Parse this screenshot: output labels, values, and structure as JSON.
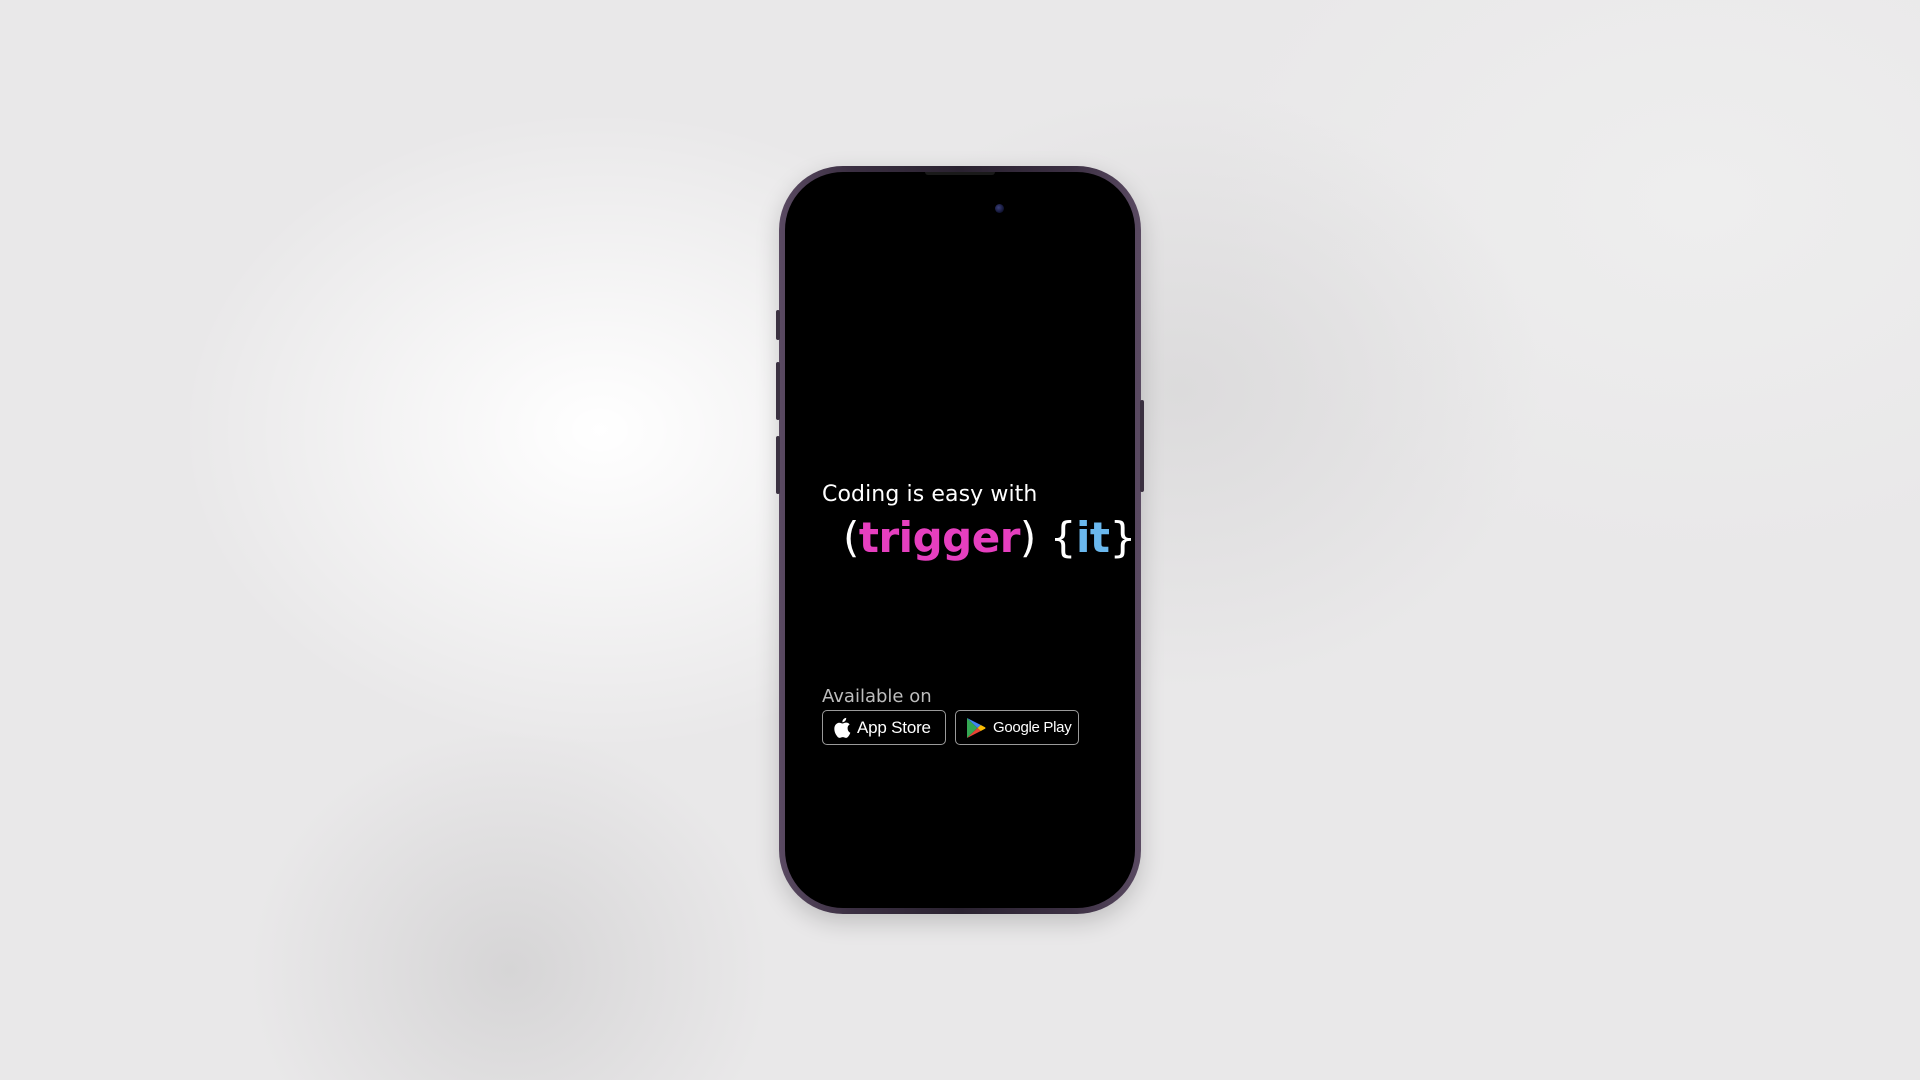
{
  "screen": {
    "headline": "Coding is easy with",
    "logo": {
      "open_paren": "(",
      "word_trigger": "trigger",
      "close_paren": ")",
      "open_brace": "{",
      "word_it": "it",
      "close_brace": "}"
    },
    "available_label": "Available on",
    "badges": {
      "app_store": {
        "label": "App Store",
        "icon": "apple-icon"
      },
      "google_play": {
        "label": "Google Play",
        "icon": "google-play-icon"
      }
    }
  },
  "colors": {
    "trigger_pink": "#e63fbf",
    "it_blue": "#6ab8ee",
    "screen_background": "#000000",
    "frame": "#3b2f42"
  }
}
